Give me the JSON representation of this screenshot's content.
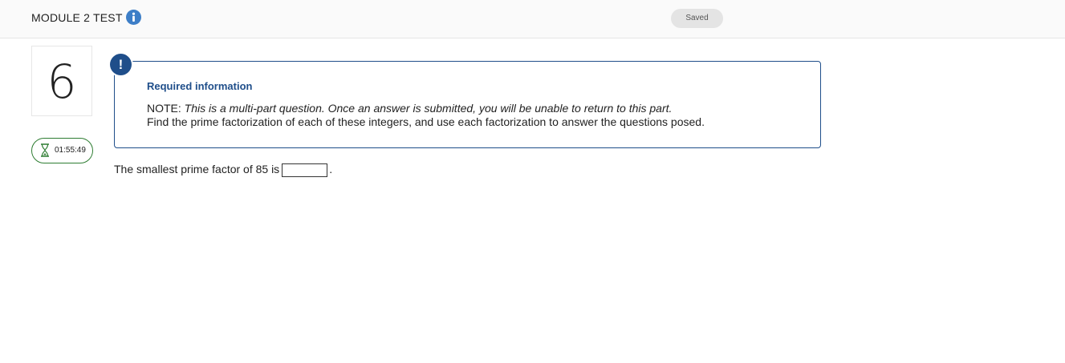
{
  "header": {
    "title": "MODULE 2 TEST",
    "info_icon": "info-icon",
    "save_status": "Saved"
  },
  "sidebar": {
    "question_number": "6",
    "timer": "01:55:49",
    "timer_icon": "hourglass-icon"
  },
  "required_info": {
    "icon": "alert-icon",
    "icon_glyph": "!",
    "title": "Required information",
    "note_label": "NOTE:",
    "note_text": "This is a multi-part question. Once an answer is submitted, you will be unable to return to this part.",
    "instructions": "Find the prime factorization of each of these integers, and use each factorization to answer the questions posed."
  },
  "question": {
    "prompt": "The smallest prime factor of 85 is",
    "answer_value": "",
    "suffix": "."
  },
  "colors": {
    "accent_blue": "#1f4e8a",
    "info_blue": "#3d7ec7",
    "timer_green": "#2e7d32"
  }
}
